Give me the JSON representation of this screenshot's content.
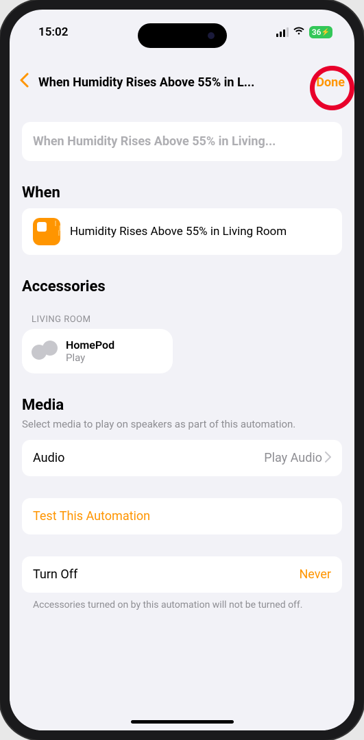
{
  "status": {
    "time": "15:02",
    "battery": "36"
  },
  "header": {
    "title": "When Humidity Rises Above 55% in L...",
    "done": "Done"
  },
  "nameField": {
    "placeholder": "When Humidity Rises Above 55% in Living..."
  },
  "when": {
    "sectionTitle": "When",
    "condition": "Humidity Rises Above 55% in Living Room"
  },
  "accessories": {
    "sectionTitle": "Accessories",
    "roomLabel": "LIVING ROOM",
    "items": [
      {
        "name": "HomePod",
        "status": "Play"
      }
    ]
  },
  "media": {
    "sectionTitle": "Media",
    "subtitle": "Select media to play on speakers as part of this automation.",
    "audioLabel": "Audio",
    "audioValue": "Play Audio"
  },
  "test": {
    "label": "Test This Automation"
  },
  "turnOff": {
    "label": "Turn Off",
    "value": "Never",
    "footer": "Accessories turned on by this automation will not be turned off."
  }
}
